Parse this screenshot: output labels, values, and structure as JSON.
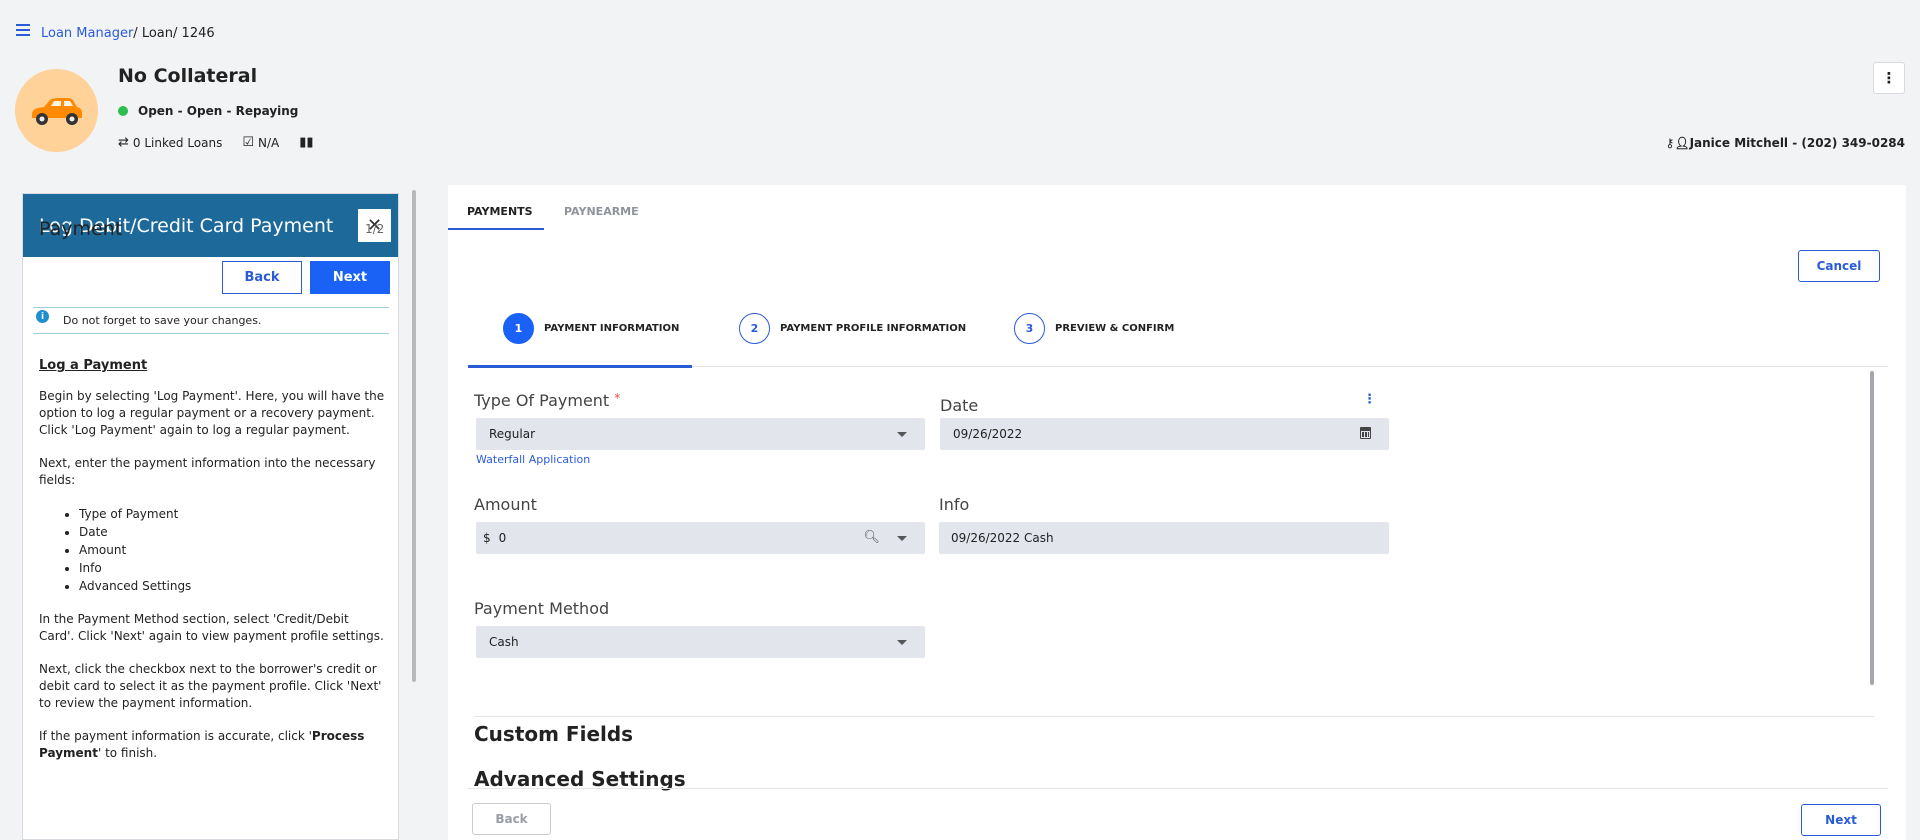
{
  "breadcrumb": {
    "root": "Loan Manager",
    "sep1": "/",
    "level2": "Loan",
    "sep2": "/",
    "id": "1246"
  },
  "loan": {
    "title": "No Collateral",
    "status": "Open - Open - Repaying",
    "linked_loans": "0 Linked Loans",
    "due": "N/A",
    "contact": "Janice Mitchell - (202) 349-0284",
    "status_color": "#2ebd4f"
  },
  "guide": {
    "title": "Log Debit/Credit Card Payment",
    "close": "✕",
    "heading": "Payment",
    "page": "1/2",
    "back": "Back",
    "next": "Next",
    "notice": "Do not forget to save your changes.",
    "section_title": "Log a Payment",
    "p1": "Begin by selecting 'Log Payment'. Here, you will have the option to log a regular payment or a recovery payment. Click 'Log Payment' again to log a regular payment.",
    "p2": "Next, enter the payment information into the necessary fields:",
    "list": [
      "Type of Payment",
      "Date",
      "Amount",
      "Info",
      "Advanced Settings"
    ],
    "p3": "In the Payment Method section, select 'Credit/Debit Card'. Click 'Next' again to view payment profile settings.",
    "p4": "Next, click the checkbox next to the borrower's credit or debit card to select it as the payment profile. Click 'Next' to review the payment information.",
    "p5_a": "If the payment information is accurate, click '",
    "p5_b": "Process Payment",
    "p5_c": "' to finish."
  },
  "tabs": {
    "payments": "PAYMENTS",
    "paynearme": "PAYNEARME"
  },
  "actions": {
    "cancel": "Cancel",
    "back": "Back",
    "next": "Next"
  },
  "steps": [
    {
      "num": "1",
      "label": "PAYMENT INFORMATION"
    },
    {
      "num": "2",
      "label": "PAYMENT PROFILE INFORMATION"
    },
    {
      "num": "3",
      "label": "PREVIEW & CONFIRM"
    }
  ],
  "form": {
    "type_label": "Type Of Payment",
    "type_required": "*",
    "type_value": "Regular",
    "waterfall_link": "Waterfall Application",
    "date_label": "Date",
    "date_value": "09/26/2022",
    "amount_label": "Amount",
    "amount_currency": "$",
    "amount_value": "0",
    "info_label": "Info",
    "info_value": "09/26/2022 Cash",
    "method_label": "Payment Method",
    "method_value": "Cash"
  },
  "sections": {
    "custom": "Custom Fields",
    "advanced": "Advanced Settings"
  },
  "colors": {
    "primary": "#1a62f5",
    "guide_header": "#1d6a9a",
    "avatar_bg": "#ffd29a"
  },
  "icons": {
    "menu": "hamburger-icon",
    "car": "car-icon",
    "more": "kebab-icon"
  }
}
